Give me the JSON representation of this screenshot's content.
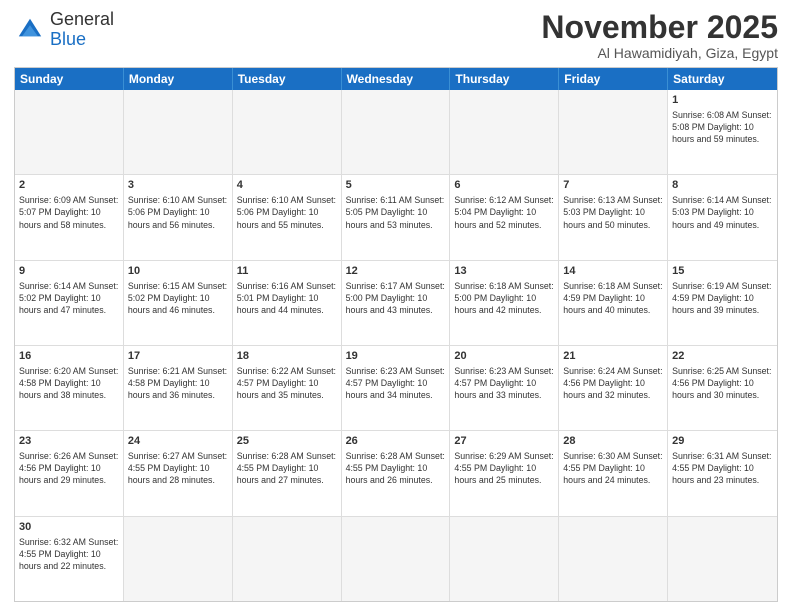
{
  "header": {
    "logo_general": "General",
    "logo_blue": "Blue",
    "month_title": "November 2025",
    "location": "Al Hawamidiyah, Giza, Egypt"
  },
  "days_of_week": [
    "Sunday",
    "Monday",
    "Tuesday",
    "Wednesday",
    "Thursday",
    "Friday",
    "Saturday"
  ],
  "weeks": [
    [
      {
        "day": "",
        "info": ""
      },
      {
        "day": "",
        "info": ""
      },
      {
        "day": "",
        "info": ""
      },
      {
        "day": "",
        "info": ""
      },
      {
        "day": "",
        "info": ""
      },
      {
        "day": "",
        "info": ""
      },
      {
        "day": "1",
        "info": "Sunrise: 6:08 AM\nSunset: 5:08 PM\nDaylight: 10 hours and 59 minutes."
      }
    ],
    [
      {
        "day": "2",
        "info": "Sunrise: 6:09 AM\nSunset: 5:07 PM\nDaylight: 10 hours and 58 minutes."
      },
      {
        "day": "3",
        "info": "Sunrise: 6:10 AM\nSunset: 5:06 PM\nDaylight: 10 hours and 56 minutes."
      },
      {
        "day": "4",
        "info": "Sunrise: 6:10 AM\nSunset: 5:06 PM\nDaylight: 10 hours and 55 minutes."
      },
      {
        "day": "5",
        "info": "Sunrise: 6:11 AM\nSunset: 5:05 PM\nDaylight: 10 hours and 53 minutes."
      },
      {
        "day": "6",
        "info": "Sunrise: 6:12 AM\nSunset: 5:04 PM\nDaylight: 10 hours and 52 minutes."
      },
      {
        "day": "7",
        "info": "Sunrise: 6:13 AM\nSunset: 5:03 PM\nDaylight: 10 hours and 50 minutes."
      },
      {
        "day": "8",
        "info": "Sunrise: 6:14 AM\nSunset: 5:03 PM\nDaylight: 10 hours and 49 minutes."
      }
    ],
    [
      {
        "day": "9",
        "info": "Sunrise: 6:14 AM\nSunset: 5:02 PM\nDaylight: 10 hours and 47 minutes."
      },
      {
        "day": "10",
        "info": "Sunrise: 6:15 AM\nSunset: 5:02 PM\nDaylight: 10 hours and 46 minutes."
      },
      {
        "day": "11",
        "info": "Sunrise: 6:16 AM\nSunset: 5:01 PM\nDaylight: 10 hours and 44 minutes."
      },
      {
        "day": "12",
        "info": "Sunrise: 6:17 AM\nSunset: 5:00 PM\nDaylight: 10 hours and 43 minutes."
      },
      {
        "day": "13",
        "info": "Sunrise: 6:18 AM\nSunset: 5:00 PM\nDaylight: 10 hours and 42 minutes."
      },
      {
        "day": "14",
        "info": "Sunrise: 6:18 AM\nSunset: 4:59 PM\nDaylight: 10 hours and 40 minutes."
      },
      {
        "day": "15",
        "info": "Sunrise: 6:19 AM\nSunset: 4:59 PM\nDaylight: 10 hours and 39 minutes."
      }
    ],
    [
      {
        "day": "16",
        "info": "Sunrise: 6:20 AM\nSunset: 4:58 PM\nDaylight: 10 hours and 38 minutes."
      },
      {
        "day": "17",
        "info": "Sunrise: 6:21 AM\nSunset: 4:58 PM\nDaylight: 10 hours and 36 minutes."
      },
      {
        "day": "18",
        "info": "Sunrise: 6:22 AM\nSunset: 4:57 PM\nDaylight: 10 hours and 35 minutes."
      },
      {
        "day": "19",
        "info": "Sunrise: 6:23 AM\nSunset: 4:57 PM\nDaylight: 10 hours and 34 minutes."
      },
      {
        "day": "20",
        "info": "Sunrise: 6:23 AM\nSunset: 4:57 PM\nDaylight: 10 hours and 33 minutes."
      },
      {
        "day": "21",
        "info": "Sunrise: 6:24 AM\nSunset: 4:56 PM\nDaylight: 10 hours and 32 minutes."
      },
      {
        "day": "22",
        "info": "Sunrise: 6:25 AM\nSunset: 4:56 PM\nDaylight: 10 hours and 30 minutes."
      }
    ],
    [
      {
        "day": "23",
        "info": "Sunrise: 6:26 AM\nSunset: 4:56 PM\nDaylight: 10 hours and 29 minutes."
      },
      {
        "day": "24",
        "info": "Sunrise: 6:27 AM\nSunset: 4:55 PM\nDaylight: 10 hours and 28 minutes."
      },
      {
        "day": "25",
        "info": "Sunrise: 6:28 AM\nSunset: 4:55 PM\nDaylight: 10 hours and 27 minutes."
      },
      {
        "day": "26",
        "info": "Sunrise: 6:28 AM\nSunset: 4:55 PM\nDaylight: 10 hours and 26 minutes."
      },
      {
        "day": "27",
        "info": "Sunrise: 6:29 AM\nSunset: 4:55 PM\nDaylight: 10 hours and 25 minutes."
      },
      {
        "day": "28",
        "info": "Sunrise: 6:30 AM\nSunset: 4:55 PM\nDaylight: 10 hours and 24 minutes."
      },
      {
        "day": "29",
        "info": "Sunrise: 6:31 AM\nSunset: 4:55 PM\nDaylight: 10 hours and 23 minutes."
      }
    ],
    [
      {
        "day": "30",
        "info": "Sunrise: 6:32 AM\nSunset: 4:55 PM\nDaylight: 10 hours and 22 minutes."
      },
      {
        "day": "",
        "info": ""
      },
      {
        "day": "",
        "info": ""
      },
      {
        "day": "",
        "info": ""
      },
      {
        "day": "",
        "info": ""
      },
      {
        "day": "",
        "info": ""
      },
      {
        "day": "",
        "info": ""
      }
    ]
  ]
}
